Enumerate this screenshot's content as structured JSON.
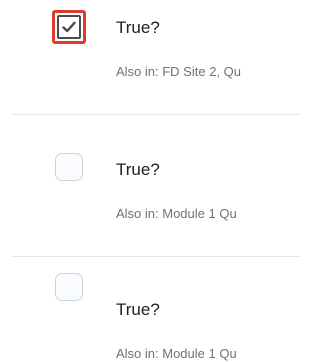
{
  "questions": [
    {
      "title": "True?",
      "also_in": "Also in: FD Site 2, Qu",
      "checked": true
    },
    {
      "title": "True?",
      "also_in": "Also in: Module 1 Qu",
      "checked": false
    },
    {
      "title": "True?",
      "also_in": "Also in: Module 1 Qu",
      "checked": false
    }
  ],
  "colors": {
    "focus_outline": "#e03a2f",
    "checkbox_border": "#cdd5dc",
    "checkbox_fill": "#f9fbff",
    "title_text": "#202122",
    "meta_text": "#6e7376",
    "divider": "#e6eaf0"
  },
  "icons": {
    "checked": "checkmark-icon"
  }
}
